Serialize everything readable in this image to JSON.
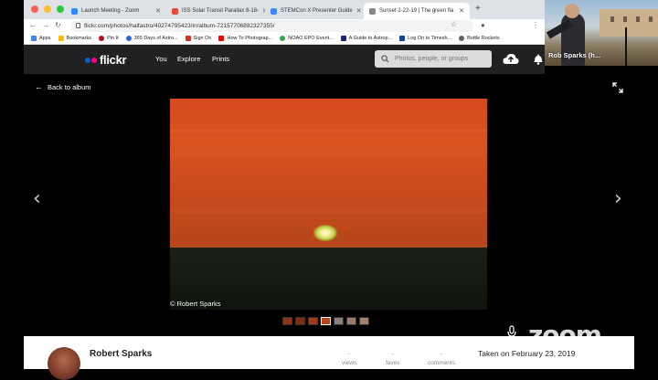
{
  "browser": {
    "tabs": [
      {
        "label": "Launch Meeting - Zoom",
        "color": "#2d8cff"
      },
      {
        "label": "ISS Solar Transit Parallax 8-18-",
        "color": "#e8453c"
      },
      {
        "label": "STEMCon X Presenter Guide",
        "color": "#4285f4"
      },
      {
        "label": "Sunset 2-22-19 | The green fla",
        "color": "#888888"
      }
    ],
    "new_tab": "+",
    "url": "flickr.com/photos/halfastro/40274795423/in/album-72157706892327355/",
    "bookmarks": [
      {
        "label": "Apps",
        "color": "#4285f4"
      },
      {
        "label": "Bookmarks",
        "color": "#fbbc04"
      },
      {
        "label": "Pin It",
        "color": "#bd081c"
      },
      {
        "label": "365 Days of Astro...",
        "color": "#3367d6"
      },
      {
        "label": "Sign On",
        "color": "#d93025"
      },
      {
        "label": "How To Photograp...",
        "color": "#ff0000"
      },
      {
        "label": "NOAO EPO Event...",
        "color": "#34a853"
      },
      {
        "label": "A Guide to Astrop...",
        "color": "#1a237e"
      },
      {
        "label": "Log On to Timesh...",
        "color": "#0d47a1"
      },
      {
        "label": "Bottle Rockets",
        "color": "#5f6368"
      }
    ]
  },
  "webcam": {
    "name": "Rob Sparks (h..."
  },
  "flickr": {
    "logo": "flickr",
    "nav": [
      "You",
      "Explore",
      "Prints"
    ],
    "search_placeholder": "Photos, people, or groups",
    "back_label": "Back to album",
    "photo_credit": "© Robert Sparks",
    "author": "Robert Sparks",
    "stats": [
      {
        "value": "-",
        "label": "views"
      },
      {
        "value": "-",
        "label": "faves"
      },
      {
        "value": "-",
        "label": "comments"
      }
    ],
    "taken": "Taken on February 23, 2019"
  },
  "zoom": {
    "watermark": "zoom"
  },
  "colors": {
    "flickr_blue": "#0063dc",
    "flickr_pink": "#ff0084",
    "header_bg": "#212124"
  }
}
